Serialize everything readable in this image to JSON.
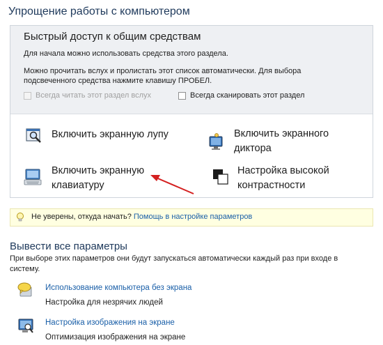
{
  "page": {
    "title": "Упрощение работы с компьютером"
  },
  "quick_access": {
    "title": "Быстрый доступ к общим средствам",
    "line1": "Для начала можно использовать средства этого раздела.",
    "line2": "Можно прочитать вслух и пролистать этот список автоматически. Для выбора",
    "line3": "подсвеченного средства нажмите клавишу ПРОБЕЛ.",
    "always_read": {
      "label": "Всегда читать этот раздел вслух",
      "checked": false,
      "enabled": false
    },
    "always_scan": {
      "label": "Всегда сканировать этот раздел",
      "checked": false,
      "enabled": true
    }
  },
  "tools": {
    "magnifier": {
      "label": "Включить экранную лупу",
      "icon": "magnifier-icon"
    },
    "narrator": {
      "line1": "Включить экранного",
      "line2": "диктора",
      "icon": "narrator-icon"
    },
    "keyboard": {
      "line1": "Включить экранную",
      "line2": "клавиатуру",
      "icon": "keyboard-icon"
    },
    "contrast": {
      "line1": "Настройка высокой",
      "line2": "контрастности",
      "icon": "contrast-icon"
    }
  },
  "tip": {
    "text": "Не уверены, откуда начать?",
    "link": "Помощь в настройке параметров",
    "icon": "lightbulb-icon"
  },
  "all_settings": {
    "title": "Вывести все параметры",
    "desc_line1": "При выборе этих параметров они будут запускаться автоматически каждый раз при входе в",
    "desc_line2": "систему.",
    "items": [
      {
        "link": "Использование компьютера без экрана",
        "desc": "Настройка для незрячих людей",
        "icon": "speech-bubble-icon"
      },
      {
        "link": "Настройка изображения на экране",
        "desc": "Оптимизация изображения на экране",
        "icon": "monitor-icon"
      }
    ]
  },
  "colors": {
    "link": "#1a5fa8",
    "title": "#1e395b",
    "tip_background": "#ffffe1",
    "arrow": "#d42020"
  }
}
